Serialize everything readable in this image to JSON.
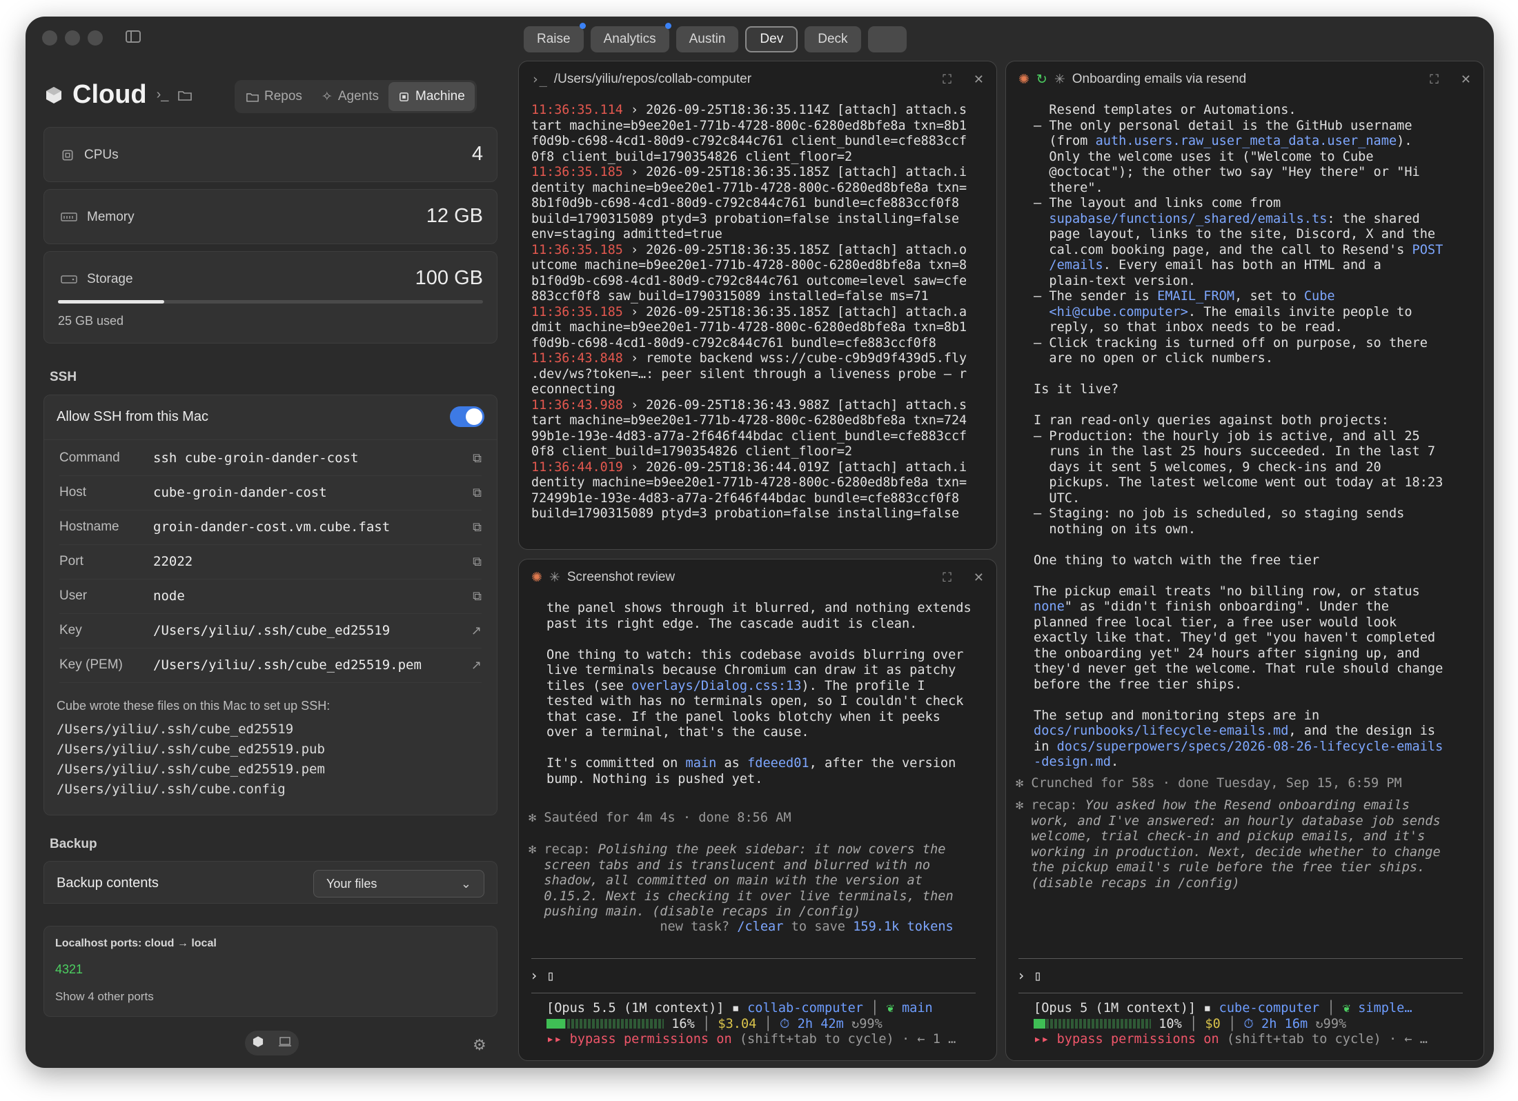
{
  "tabs": [
    "Raise",
    "Analytics",
    "Austin",
    "Dev",
    "Deck"
  ],
  "sidebar": {
    "title": "Cloud",
    "segments": [
      "Repos",
      "Agents",
      "Machine"
    ],
    "cpus": {
      "label": "CPUs",
      "value": "4"
    },
    "memory": {
      "label": "Memory",
      "value": "12 GB"
    },
    "storage": {
      "label": "Storage",
      "value": "100 GB",
      "used": "25 GB used",
      "used_fraction": 0.25
    },
    "ssh_title": "SSH",
    "ssh_toggle_label": "Allow SSH from this Mac",
    "ssh_rows": [
      {
        "k": "Command",
        "v": "ssh cube-groin-dander-cost"
      },
      {
        "k": "Host",
        "v": "cube-groin-dander-cost"
      },
      {
        "k": "Hostname",
        "v": "groin-dander-cost.vm.cube.fast"
      },
      {
        "k": "Port",
        "v": "22022"
      },
      {
        "k": "User",
        "v": "node"
      },
      {
        "k": "Key",
        "v": "/Users/yiliu/.ssh/cube_ed25519"
      },
      {
        "k": "Key (PEM)",
        "v": "/Users/yiliu/.ssh/cube_ed25519.pem"
      }
    ],
    "files_note": "Cube wrote these files on this Mac to set up SSH:",
    "files": [
      "/Users/yiliu/.ssh/cube_ed25519",
      "/Users/yiliu/.ssh/cube_ed25519.pub",
      "/Users/yiliu/.ssh/cube_ed25519.pem",
      "/Users/yiliu/.ssh/cube.config"
    ],
    "backup_title": "Backup",
    "backup_label": "Backup contents",
    "backup_select": "Your files",
    "ports_title": "Localhost ports: cloud → local",
    "port": "4321",
    "ports_more": "Show 4 other ports"
  },
  "terminal": {
    "title": "/Users/yiliu/repos/collab-computer",
    "log": [
      {
        "t": "11:36:35.114",
        "m": " › 2026-09-25T18:36:35.114Z [attach] attach.s\ntart machine=b9ee20e1-771b-4728-800c-6280ed8bfe8a txn=8b1\nf0d9b-c698-4cd1-80d9-c792c844c761 client_bundle=cfe883ccf\n0f8 client_build=1790354826 client_floor=2"
      },
      {
        "t": "11:36:35.185",
        "m": " › 2026-09-25T18:36:35.185Z [attach] attach.i\ndentity machine=b9ee20e1-771b-4728-800c-6280ed8bfe8a txn=\n8b1f0d9b-c698-4cd1-80d9-c792c844c761 bundle=cfe883ccf0f8 \nbuild=1790315089 ptyd=3 probation=false installing=false \nenv=staging admitted=true"
      },
      {
        "t": "11:36:35.185",
        "m": " › 2026-09-25T18:36:35.185Z [attach] attach.o\nutcome machine=b9ee20e1-771b-4728-800c-6280ed8bfe8a txn=8\nb1f0d9b-c698-4cd1-80d9-c792c844c761 outcome=level saw=cfe\n883ccf0f8 saw_build=1790315089 installed=false ms=71"
      },
      {
        "t": "11:36:35.185",
        "m": " › 2026-09-25T18:36:35.185Z [attach] attach.a\ndmit machine=b9ee20e1-771b-4728-800c-6280ed8bfe8a txn=8b1\nf0d9b-c698-4cd1-80d9-c792c844c761 bundle=cfe883ccf0f8"
      },
      {
        "t": "11:36:43.848",
        "m": " › remote backend wss://cube-c9b9d9f439d5.fly\n.dev/ws?token=…: peer silent through a liveness probe — r\neconnecting"
      },
      {
        "t": "11:36:43.988",
        "m": " › 2026-09-25T18:36:43.988Z [attach] attach.s\ntart machine=b9ee20e1-771b-4728-800c-6280ed8bfe8a txn=724\n99b1e-193e-4d83-a77a-2f646f44bdac client_bundle=cfe883ccf\n0f8 client_build=1790354826 client_floor=2"
      },
      {
        "t": "11:36:44.019",
        "m": " › 2026-09-25T18:36:44.019Z [attach] attach.i\ndentity machine=b9ee20e1-771b-4728-800c-6280ed8bfe8a txn=\n72499b1e-193e-4d83-a77a-2f646f44bdac bundle=cfe883ccf0f8 \nbuild=1790315089 ptyd=3 probation=false installing=false"
      }
    ]
  },
  "screenshot_review": {
    "title": "Screenshot review",
    "p1a": "the panel shows through it blurred, and nothing extends\npast its right edge. The cascade audit is clean.\n\nOne thing to watch: this codebase avoids blurring over\nlive terminals because Chromium can draw it as patchy\ntiles (see ",
    "p1link": "overlays/Dialog.css:13",
    "p1b": "). The profile I\ntested with has no terminals open, so I couldn't check\nthat case. If the panel looks blotchy when it peeks\nover a terminal, that's the cause.\n\nIt's committed on ",
    "branch": "main",
    "p2a": " as ",
    "commit": "fdeeed01",
    "p2b": ", after the version\nbump. Nothing is pushed yet.",
    "sauteed": "✻ Sautéed for 4m 4s · done 8:56 AM",
    "recap_label": "✻ recap: ",
    "recap": "Polishing the peek sidebar: it now covers the\n  screen tabs and is translucent and blurred with no\n  shadow, all committed on main with the version at\n  0.15.2. Next is checking it over live terminals, then\n  pushing main. (disable recaps in /config)",
    "newtask_a": "                 new task? ",
    "clear": "/clear",
    "newtask_b": " to save ",
    "tokens": "159.1k tokens",
    "prompt": "› ▯",
    "status_model": " [Opus 5.5 (1M context)] ",
    "status_repo": "collab-computer",
    "status_branch": "main",
    "status_pct": " 16%",
    "status_cost": "$3.04",
    "status_time": "⏱ 2h 42m",
    "status_cache": "↻99%",
    "status_bypass": " ▸▸ bypass permissions on",
    "status_hint": " (shift+tab to cycle) · ← 1 …",
    "fill": 0.16
  },
  "onboarding": {
    "title": "Onboarding emails via resend",
    "status_model": " [Opus 5 (1M context)] ",
    "status_repo": "cube-computer",
    "status_branch": "simple…",
    "status_pct": " 10%",
    "status_cost": "$0",
    "status_time": "⏱ 2h 16m",
    "status_cache": "↻99%",
    "status_bypass": " ▸▸ bypass permissions on",
    "status_hint": " (shift+tab to cycle) · ← …",
    "prompt": "› ▯",
    "crunched": "✻ Crunched for 58s · done Tuesday, Sep 15, 6:59 PM",
    "recap_label": "✻ recap: ",
    "recap": "You asked how the Resend onboarding emails\n  work, and I've answered: an hourly database job sends\n  welcome, trial check-in and pickup emails, and it's\n  working in production. Next, decide whether to change\n  the pickup email's rule before the free tier ships.\n  (disable recaps in /config)",
    "fill": 0.1,
    "b1": "  Resend templates or Automations.\n– The only personal detail is the GitHub username\n  (from ",
    "b1l": "auth.users.raw_user_meta_data.user_name",
    "b2": ").\n  Only the welcome uses it (\"Welcome to Cube\n  @octocat\"); the other two say \"Hey there\" or \"Hi\n  there\".\n– The layout and links come from\n  ",
    "b2l": "supabase/functions/_shared/emails.ts",
    "b3": ": the shared\n  page layout, links to the site, Discord, X and the\n  cal.com booking page, and the call to Resend's ",
    "b3l": "POST\n  /emails",
    "b4": ". Every email has both an HTML and a\n  plain-text version.\n– The sender is ",
    "b4l": "EMAIL_FROM",
    "b5": ", set to ",
    "b5l": "Cube\n  <hi@cube.computer>",
    "b6": ". The emails invite people to\n  reply, so that inbox needs to be read.\n– Click tracking is turned off on purpose, so there\n  are no open or click numbers.\n\nIs it live?\n\nI ran read-only queries against both projects:\n– Production: the hourly job is active, and all 25\n  runs in the last 25 hours succeeded. In the last 7\n  days it sent 5 welcomes, 9 check-ins and 20\n  pickups. The latest welcome went out today at 18:23\n  UTC.\n– Staging: no job is scheduled, so staging sends\n  nothing on its own.\n\nOne thing to watch with the free tier\n\nThe pickup email treats \"no billing row, or status\n",
    "b6l": "none",
    "b7": "\" as \"didn't finish onboarding\". Under the\nplanned free local tier, a free user would look\nexactly like that. They'd get \"you haven't completed\nthe onboarding yet\" 24 hours after signing up, and\nthey'd never get the welcome. That rule should change\nbefore the free tier ships.\n\nThe setup and monitoring steps are in\n",
    "b7l": "docs/runbooks/lifecycle-emails.md",
    "b8": ", and the design is\nin ",
    "b8l": "docs/superpowers/specs/2026-08-26-lifecycle-emails\n-design.md",
    "b9": "."
  }
}
